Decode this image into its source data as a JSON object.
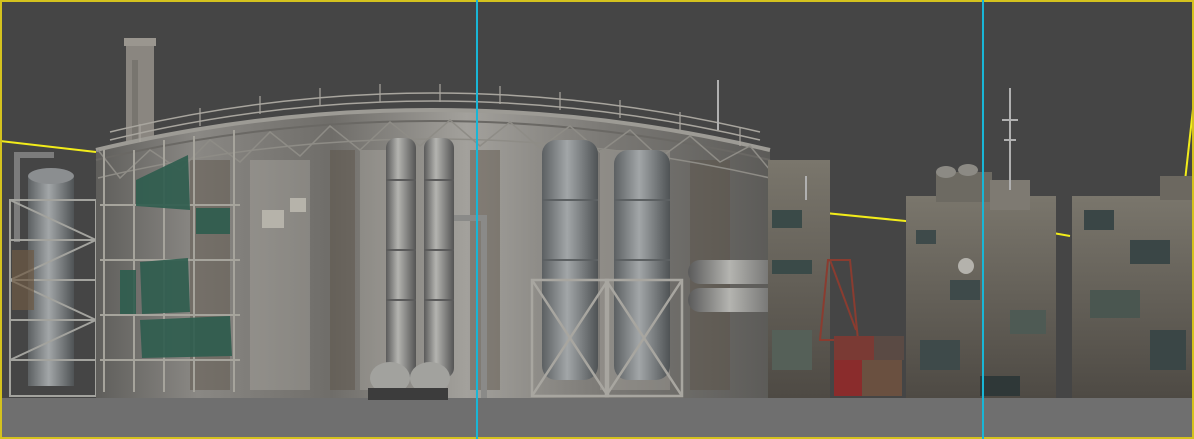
{
  "viewport": {
    "background": "#454545",
    "ground_color": "#6f6f6f",
    "frame_color": "#d4c21e",
    "guide_color": "#19b6d6",
    "horizon_line_color": "#f2ec1a"
  },
  "scene": {
    "objects": [
      {
        "name": "oil-storage-tank",
        "color": "#7c7a76"
      },
      {
        "name": "chimney-stack",
        "color": "#8a8680"
      },
      {
        "name": "scaffolding",
        "color": "#9a9890"
      },
      {
        "name": "green-tarp",
        "color": "#2e5d4e"
      },
      {
        "name": "vertical-pipes",
        "color": "#8c8c8c"
      },
      {
        "name": "filter-towers",
        "color": "#7f8486"
      },
      {
        "name": "distillation-column",
        "color": "#7a7c80"
      },
      {
        "name": "shanty-buildings",
        "color": "#6b665e"
      },
      {
        "name": "cargo-containers",
        "color": "#7a3a34"
      },
      {
        "name": "radio-antennas",
        "color": "#b0b0b0"
      }
    ]
  }
}
